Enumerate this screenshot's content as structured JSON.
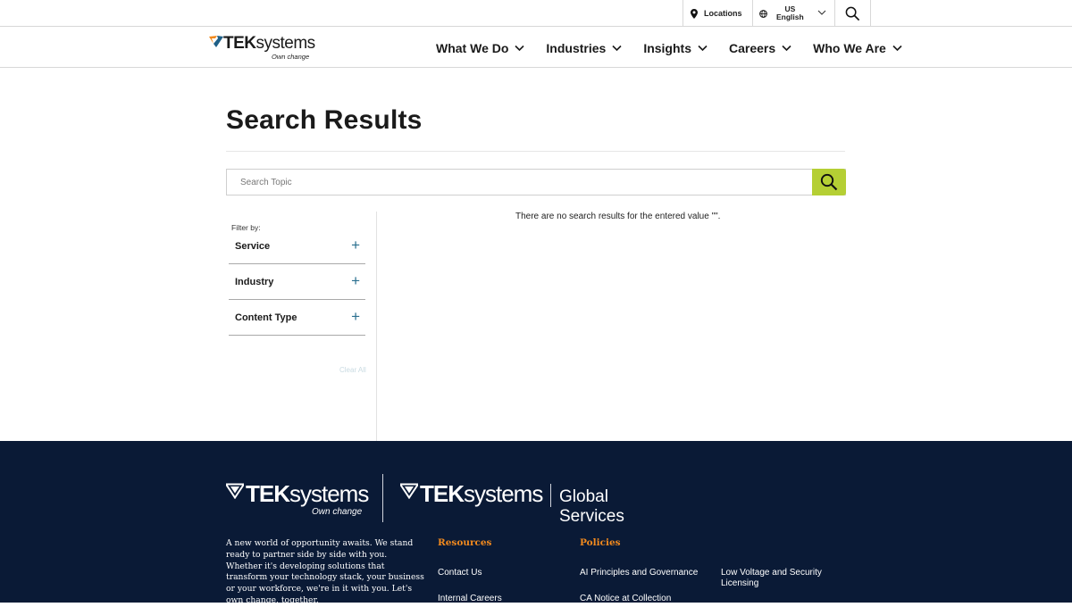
{
  "utility": {
    "locations_label": "Locations",
    "region": "US",
    "language": "English"
  },
  "nav": {
    "logo_brand_bold": "TEK",
    "logo_brand_light": "systems",
    "logo_tagline": "Own change",
    "items": [
      {
        "label": "What We Do"
      },
      {
        "label": "Industries"
      },
      {
        "label": "Insights"
      },
      {
        "label": "Careers"
      },
      {
        "label": "Who We Are"
      }
    ]
  },
  "main": {
    "title": "Search Results",
    "search_placeholder": "Search Topic",
    "search_value": "",
    "filter_label": "Filter by:",
    "facets": [
      {
        "label": "Service"
      },
      {
        "label": "Industry"
      },
      {
        "label": "Content Type"
      }
    ],
    "clear_all": "Clear All",
    "no_results": "There are no search results for the entered value \"\"."
  },
  "footer": {
    "logo_brand_bold": "TEK",
    "logo_brand_light": "systems",
    "logo_tagline": "Own change",
    "global_services": "Global Services",
    "about": "A new world of opportunity awaits. We stand ready to partner side by side with you. Whether it's developing solutions that transform your technology stack, your business or your workforce, we're in it with you. Let's own change, together.",
    "resources_heading": "Resources",
    "policies_heading": "Policies",
    "resources": [
      "Contact Us",
      "Internal Careers"
    ],
    "policies_col1": [
      "AI Principles and Governance",
      "CA Notice at Collection"
    ],
    "policies_col2": [
      "Low Voltage and Security Licensing"
    ]
  },
  "colors": {
    "accent_green": "#b5cf34",
    "footer_bg": "#0a1a36",
    "footer_heading": "#f28a1e",
    "plus_icon": "#2a6f8f"
  }
}
